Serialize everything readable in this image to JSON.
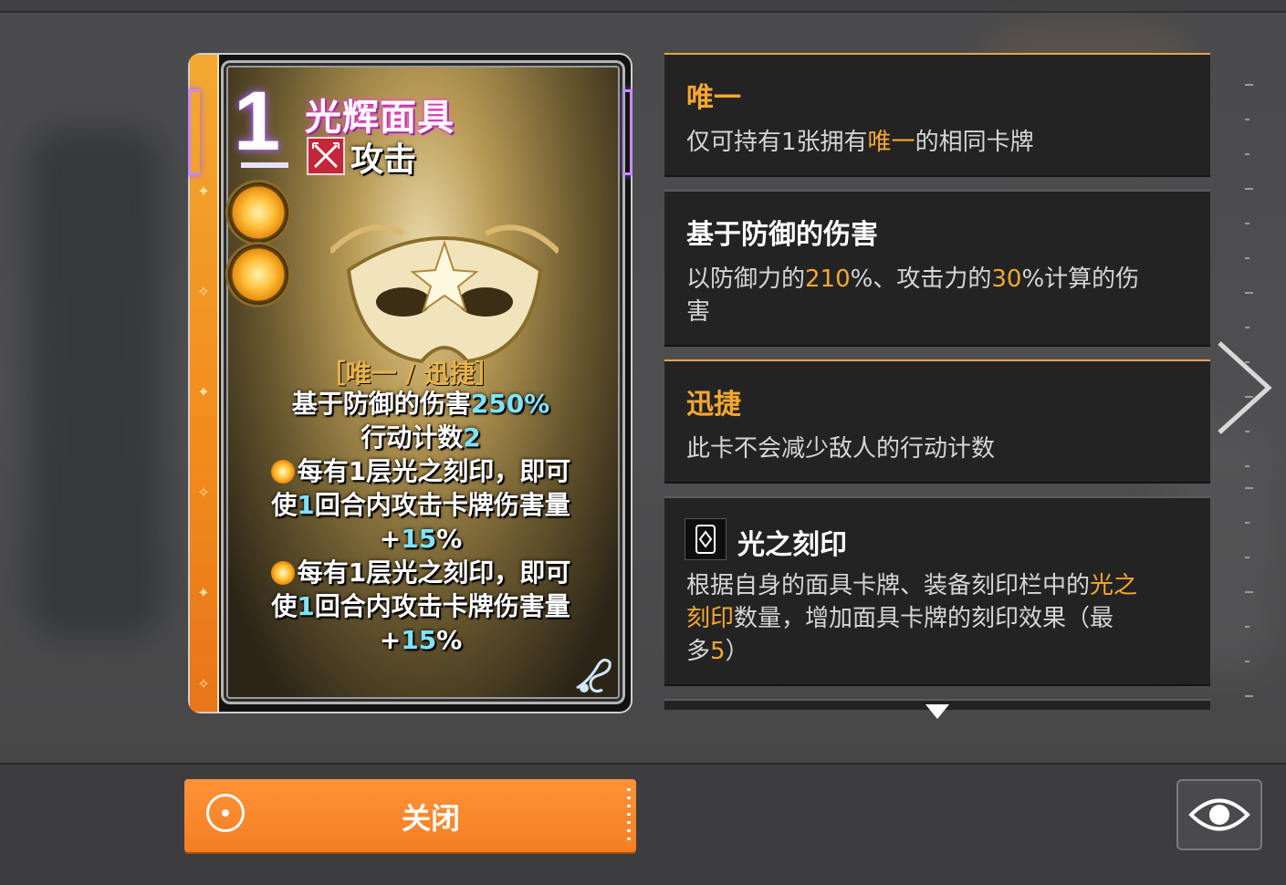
{
  "card": {
    "cost": "1",
    "name": "光辉面具",
    "type_label": "攻击",
    "type_icon": "crossed-swords-icon",
    "tags": "［唯一 / 迅捷］",
    "desc": {
      "line1_text": "基于防御的伤害",
      "line1_num": "250%",
      "line2_text": "行动计数",
      "line2_num": "2",
      "effect1_a": "每有1层光之刻印，即可",
      "effect1_b_pre": "使",
      "effect1_b_num": "1",
      "effect1_b_post": "回合内攻击卡牌伤害量",
      "effect1_c_pre": "+",
      "effect1_c_num": "15",
      "effect1_c_post": "%",
      "effect2_a": "每有1层光之刻印，即可",
      "effect2_b_pre": "使",
      "effect2_b_num": "1",
      "effect2_b_post": "回合内攻击卡牌伤害量",
      "effect2_c_pre": "+",
      "effect2_c_num": "15",
      "effect2_c_post": "%"
    }
  },
  "panels": {
    "unique": {
      "title": "唯一",
      "body_pre": "仅可持有1张拥有",
      "body_hl": "唯一",
      "body_post": "的相同卡牌"
    },
    "def_damage": {
      "title": "基于防御的伤害",
      "b1": "以防御力的",
      "n1": "210",
      "b2": "%、攻击力的",
      "n2": "30",
      "b3": "%计算的伤",
      "b4": "害"
    },
    "swift": {
      "title": "迅捷",
      "body": "此卡不会减少敌人的行动计数"
    },
    "light_mark": {
      "title": "光之刻印",
      "icon": "mark-card-icon",
      "b1": "根据自身的面具卡牌、装备刻印栏中的",
      "hl1": "光之",
      "hl2": "刻印",
      "b2": "数量，增加面具卡牌的刻印效果（最",
      "b3": "多",
      "n": "5",
      "b4": "）"
    }
  },
  "buttons": {
    "close_label": "关闭"
  },
  "colors": {
    "accent": "#f47f23",
    "highlight": "#f6a72f",
    "cyan_num": "#7fe3ff",
    "panel_bg": "#232324"
  }
}
